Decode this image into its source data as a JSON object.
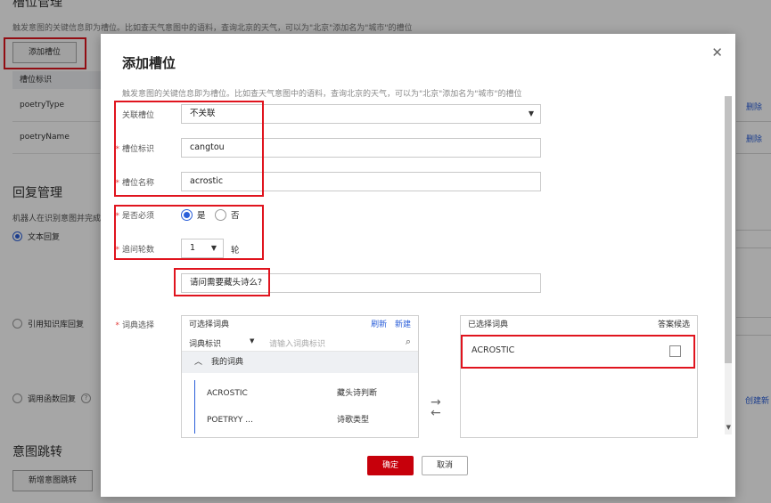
{
  "background": {
    "section_title": "槽位管理",
    "section_desc": "触发意图的关键信息即为槽位。比如查天气意图中的语料，查询北京的天气，可以为\"北京\"添加名为\"城市\"的槽位",
    "add_slot_button": "添加槽位",
    "table_header": "槽位标识",
    "rows": [
      "poetryType",
      "poetryName"
    ],
    "row_action": "删除",
    "reply_title": "回复管理",
    "reply_desc": "机器人在识别意图并完成",
    "reply_options": [
      "文本回复",
      "引用知识库回复",
      "调用函数回复"
    ],
    "create_new": "创建新",
    "intent_jump_title": "意图跳转",
    "new_jump_button": "新增意图跳转"
  },
  "modal": {
    "title": "添加槽位",
    "description": "触发意图的关键信息即为槽位。比如查天气意图中的语料，查询北京的天气，可以为\"北京\"添加名为\"城市\"的槽位",
    "fields": {
      "associated_slot": {
        "label": "关联槽位",
        "value": "不关联"
      },
      "slot_id": {
        "label": "槽位标识",
        "value": "cangtou"
      },
      "slot_name": {
        "label": "槽位名称",
        "value": "acrostic"
      },
      "required": {
        "label": "是否必须",
        "yes": "是",
        "no": "否",
        "selected": "是"
      },
      "ask_rounds": {
        "label": "追问轮数",
        "value": "1",
        "unit": "轮"
      },
      "prompt": {
        "value": "请问需要藏头诗么?"
      },
      "dictionary": {
        "label": "词典选择"
      }
    },
    "available_dict": {
      "title": "可选择词典",
      "refresh": "刷新",
      "new": "新建",
      "filter_select": "词典标识",
      "search_placeholder": "请输入词典标识",
      "group": "我的词典",
      "items": [
        {
          "id": "ACROSTIC",
          "desc": "藏头诗判断"
        },
        {
          "id": "POETRYY ...",
          "desc": "诗歌类型"
        }
      ]
    },
    "selected_dict": {
      "title": "已选择词典",
      "answer_candidate": "答案候选",
      "items": [
        {
          "id": "ACROSTIC",
          "checked": false
        }
      ]
    },
    "confirm_button": "确定",
    "cancel_button": "取消"
  }
}
